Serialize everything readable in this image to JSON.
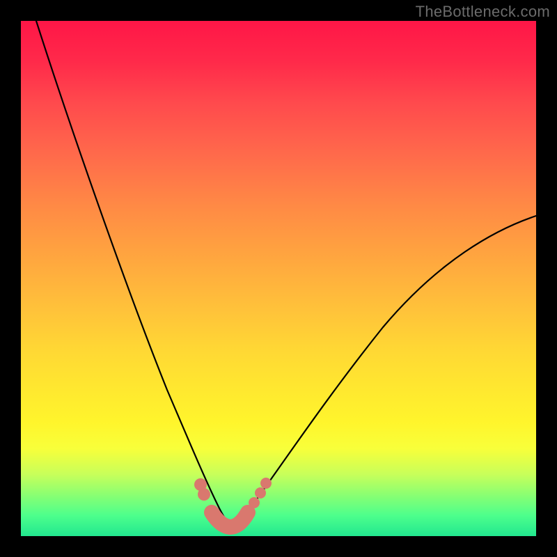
{
  "watermark": "TheBottleneck.com",
  "colors": {
    "marker": "#d9786e",
    "curve": "#000000"
  },
  "chart_data": {
    "type": "line",
    "title": "",
    "xlabel": "",
    "ylabel": "",
    "xlim": [
      0,
      100
    ],
    "ylim": [
      0,
      100
    ],
    "grid": false,
    "series": [
      {
        "name": "left-branch",
        "x": [
          3,
          8,
          14,
          20,
          25,
          29,
          32,
          35,
          37,
          39,
          40
        ],
        "values": [
          100,
          82,
          62,
          45,
          31,
          21,
          14,
          9,
          5,
          3,
          2
        ]
      },
      {
        "name": "right-branch",
        "x": [
          40,
          42,
          45,
          50,
          56,
          64,
          74,
          86,
          100
        ],
        "values": [
          2,
          3,
          5,
          9,
          16,
          26,
          38,
          50,
          62
        ]
      }
    ],
    "highlight_points": [
      {
        "branch": "left",
        "x": 35,
        "y": 9
      },
      {
        "branch": "left",
        "x": 35.6,
        "y": 7.8
      },
      {
        "branch": "right",
        "x": 44.5,
        "y": 5.5
      },
      {
        "branch": "right",
        "x": 46,
        "y": 7.2
      },
      {
        "branch": "right",
        "x": 47.2,
        "y": 8.6
      }
    ],
    "highlight_band": {
      "start_x": 36.5,
      "end_x": 43.5,
      "comment": "thick salmon segment along the curve trough"
    }
  }
}
